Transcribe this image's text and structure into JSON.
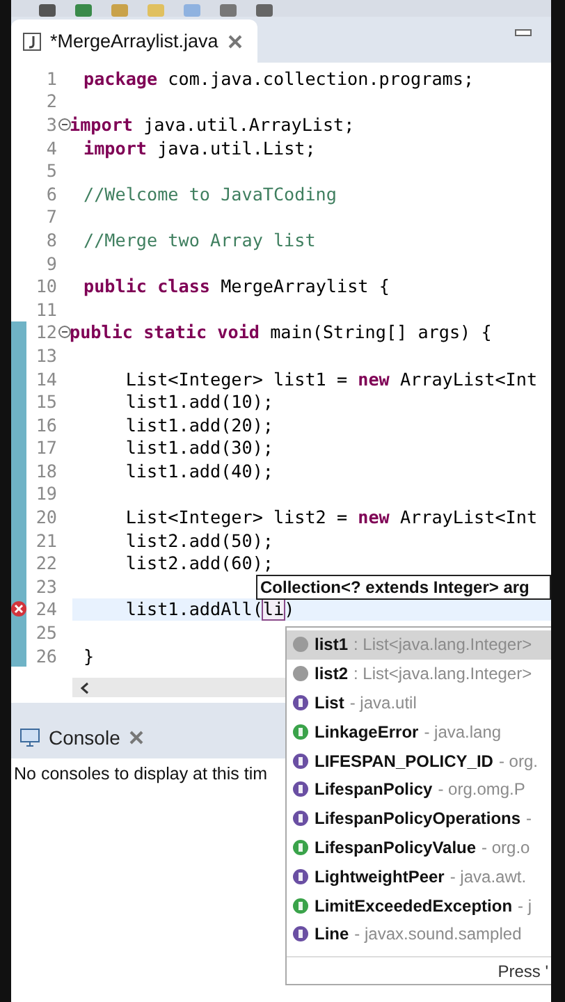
{
  "editor": {
    "tab": {
      "title": "*MergeArraylist.java",
      "dirty": true
    },
    "lines": [
      {
        "number": "1",
        "tokens": [
          {
            "kind": "keyword",
            "text": "package"
          },
          {
            "kind": "plain",
            "text": " com.java.collection.programs;"
          }
        ]
      },
      {
        "number": "2"
      },
      {
        "number": "3",
        "fold": true,
        "tokens": [
          {
            "kind": "keyword",
            "text": "import"
          },
          {
            "kind": "plain",
            "text": " java.util.ArrayList;"
          }
        ]
      },
      {
        "number": "4",
        "tokens": [
          {
            "kind": "keyword",
            "text": "import"
          },
          {
            "kind": "plain",
            "text": " java.util.List;"
          }
        ]
      },
      {
        "number": "5"
      },
      {
        "number": "6",
        "tokens": [
          {
            "kind": "comment",
            "text": "//Welcome to JavaTCoding"
          }
        ]
      },
      {
        "number": "7"
      },
      {
        "number": "8",
        "tokens": [
          {
            "kind": "comment",
            "text": "//Merge two Array list"
          }
        ]
      },
      {
        "number": "9"
      },
      {
        "number": "10",
        "tokens": [
          {
            "kind": "keyword",
            "text": "public class"
          },
          {
            "kind": "plain",
            "text": " MergeArraylist {"
          }
        ]
      },
      {
        "number": "11"
      },
      {
        "number": "12",
        "fold": true,
        "changed": true,
        "tokens": [
          {
            "kind": "keyword",
            "text": "public static void"
          },
          {
            "kind": "plain",
            "text": " main(String[] args) {"
          }
        ]
      },
      {
        "number": "13",
        "changed": true
      },
      {
        "number": "14",
        "changed": true,
        "tokens": [
          {
            "kind": "plain",
            "text": "    List<Integer> list1 = "
          },
          {
            "kind": "keyword",
            "text": "new"
          },
          {
            "kind": "plain",
            "text": " ArrayList<Int"
          }
        ]
      },
      {
        "number": "15",
        "changed": true,
        "tokens": [
          {
            "kind": "plain",
            "text": "    list1.add(10);"
          }
        ]
      },
      {
        "number": "16",
        "changed": true,
        "tokens": [
          {
            "kind": "plain",
            "text": "    list1.add(20);"
          }
        ]
      },
      {
        "number": "17",
        "changed": true,
        "tokens": [
          {
            "kind": "plain",
            "text": "    list1.add(30);"
          }
        ]
      },
      {
        "number": "18",
        "changed": true,
        "tokens": [
          {
            "kind": "plain",
            "text": "    list1.add(40);"
          }
        ]
      },
      {
        "number": "19",
        "changed": true
      },
      {
        "number": "20",
        "changed": true,
        "tokens": [
          {
            "kind": "plain",
            "text": "    List<Integer> list2 = "
          },
          {
            "kind": "keyword",
            "text": "new"
          },
          {
            "kind": "plain",
            "text": " ArrayList<Int"
          }
        ]
      },
      {
        "number": "21",
        "changed": true,
        "tokens": [
          {
            "kind": "plain",
            "text": "    list2.add(50);"
          }
        ]
      },
      {
        "number": "22",
        "changed": true,
        "tokens": [
          {
            "kind": "plain",
            "text": "    list2.add(60);"
          }
        ]
      },
      {
        "number": "23",
        "changed": true
      },
      {
        "number": "24",
        "changed": true,
        "error": true,
        "current": true,
        "tokens": [
          {
            "kind": "plain",
            "text": "    list1.addAll("
          },
          {
            "kind": "linked",
            "text": "li"
          },
          {
            "kind": "plain",
            "text": ")"
          }
        ]
      },
      {
        "number": "25",
        "changed": true
      },
      {
        "number": "26",
        "changed": true,
        "tokens": [
          {
            "kind": "plain",
            "text": "}"
          }
        ]
      }
    ],
    "tooltip": "Collection<? extends Integer> arg",
    "completions": [
      {
        "kind": "variable",
        "name": "list1",
        "detail": ": List<java.lang.Integer>",
        "selected": true
      },
      {
        "kind": "variable",
        "name": "list2",
        "detail": ": List<java.lang.Integer>",
        "selected": false
      },
      {
        "kind": "interface",
        "name": "List",
        "detail": "- java.util",
        "selected": false
      },
      {
        "kind": "class",
        "name": "LinkageError",
        "detail": "- java.lang",
        "selected": false
      },
      {
        "kind": "interface",
        "name": "LIFESPAN_POLICY_ID",
        "detail": "- org.",
        "selected": false
      },
      {
        "kind": "interface",
        "name": "LifespanPolicy",
        "detail": "- org.omg.P",
        "selected": false
      },
      {
        "kind": "interface",
        "name": "LifespanPolicyOperations",
        "detail": "-",
        "selected": false
      },
      {
        "kind": "class",
        "name": "LifespanPolicyValue",
        "detail": "- org.o",
        "selected": false
      },
      {
        "kind": "interface",
        "name": "LightweightPeer",
        "detail": "- java.awt.",
        "selected": false
      },
      {
        "kind": "class",
        "name": "LimitExceededException",
        "detail": "- j",
        "selected": false
      },
      {
        "kind": "interface",
        "name": "Line",
        "detail": "- javax.sound.sampled",
        "selected": false
      }
    ],
    "completion_footer": "Press '"
  },
  "console": {
    "tab": "Console",
    "message": "No consoles to display at this tim"
  }
}
